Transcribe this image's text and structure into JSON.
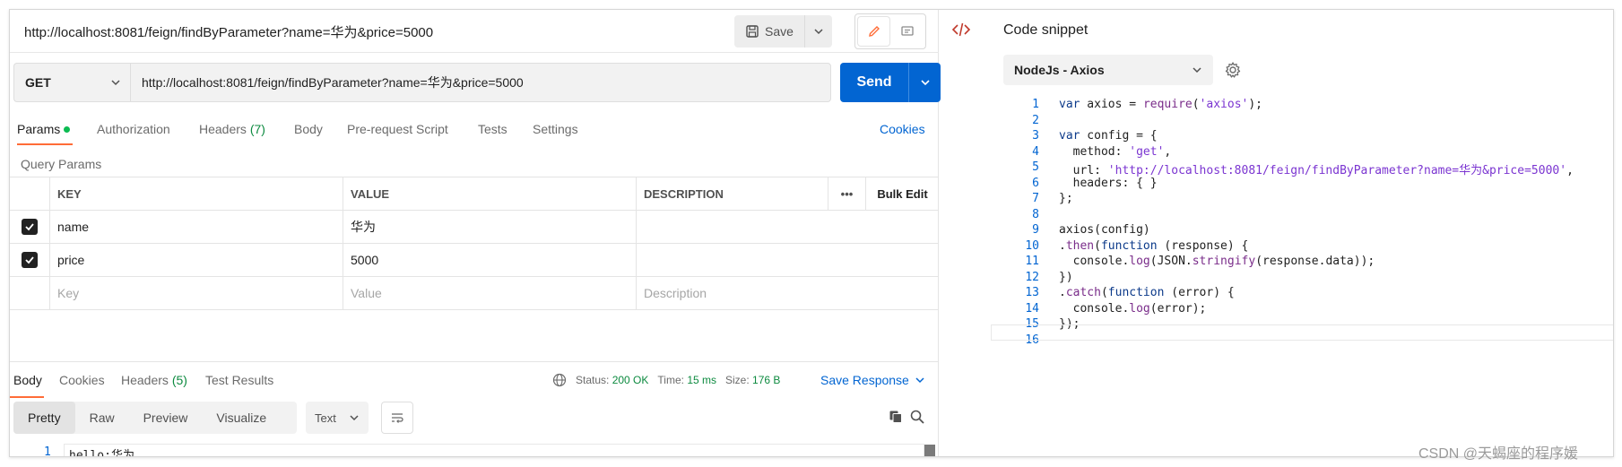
{
  "request": {
    "name": "http://localhost:8081/feign/findByParameter?name=华为&price=5000",
    "save_label": "Save",
    "method": "GET",
    "url": "http://localhost:8081/feign/findByParameter?name=华为&price=5000",
    "send_label": "Send"
  },
  "tabs": {
    "params": "Params",
    "authorization": "Authorization",
    "headers": "Headers",
    "headers_count": "(7)",
    "body": "Body",
    "prerequest": "Pre-request Script",
    "tests": "Tests",
    "settings": "Settings",
    "cookies": "Cookies"
  },
  "query_params": {
    "title": "Query Params",
    "headers": {
      "key": "KEY",
      "value": "VALUE",
      "description": "DESCRIPTION",
      "more": "•••",
      "bulk_edit": "Bulk Edit"
    },
    "rows": [
      {
        "checked": true,
        "key": "name",
        "value": "华为",
        "description": ""
      },
      {
        "checked": true,
        "key": "price",
        "value": "5000",
        "description": ""
      }
    ],
    "placeholder": {
      "key": "Key",
      "value": "Value",
      "description": "Description"
    }
  },
  "response": {
    "tabs": {
      "body": "Body",
      "cookies": "Cookies",
      "headers": "Headers",
      "headers_count": "(5)",
      "test_results": "Test Results"
    },
    "status_label": "Status:",
    "status_value": "200 OK",
    "time_label": "Time:",
    "time_value": "15 ms",
    "size_label": "Size:",
    "size_value": "176 B",
    "save_response": "Save Response",
    "formats": [
      "Pretty",
      "Raw",
      "Preview",
      "Visualize"
    ],
    "active_format": "Pretty",
    "text_type": "Text",
    "line_number": "1",
    "body_text": "hello:华为"
  },
  "snippet": {
    "title": "Code snippet",
    "language": "NodeJs - Axios",
    "lines": [
      "var axios = require('axios');",
      "",
      "var config = {",
      "  method: 'get',",
      "  url: 'http://localhost:8081/feign/findByParameter?name=华为&price=5000',",
      "  headers: { }",
      "};",
      "",
      "axios(config)",
      ".then(function (response) {",
      "  console.log(JSON.stringify(response.data));",
      "})",
      ".catch(function (error) {",
      "  console.log(error);",
      "});",
      ""
    ]
  },
  "watermark": "CSDN @天蝎座的程序媛",
  "colors": {
    "accent": "#ff6c37",
    "primary": "#0265d2",
    "success": "#0c8a3f"
  }
}
